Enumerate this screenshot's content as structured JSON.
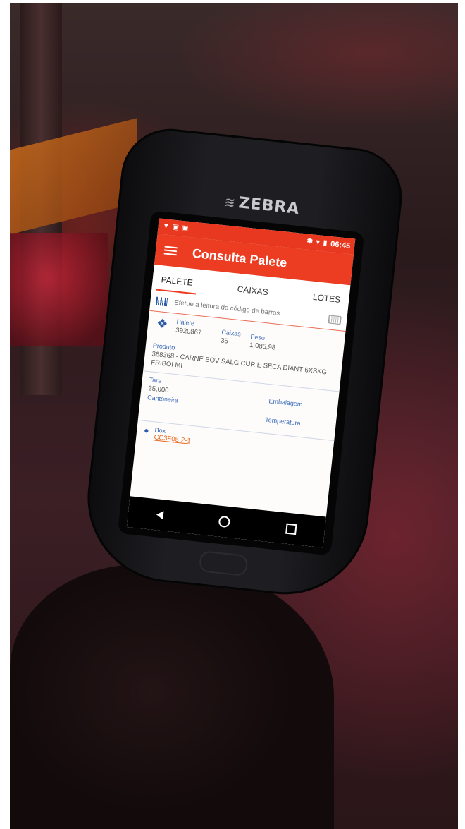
{
  "device": {
    "brand": "ZEBRA"
  },
  "status_bar": {
    "time": "06:45"
  },
  "app_bar": {
    "title": "Consulta Palete"
  },
  "tabs": [
    {
      "label": "PALETE",
      "active": true
    },
    {
      "label": "CAIXAS",
      "active": false
    },
    {
      "label": "LOTES",
      "active": false
    }
  ],
  "scan": {
    "placeholder": "Efetue a leitura do código de barras"
  },
  "pallet": {
    "palete_label": "Palete",
    "palete_value": "3920867",
    "caixas_label": "Caixas",
    "caixas_value": "35",
    "peso_label": "Peso",
    "peso_value": "1.085,98",
    "produto_label": "Produto",
    "produto_value": "368368 - CARNE BOV SALG CUR E SECA DIANT 6XSKG FRIBOI MI"
  },
  "details": {
    "tara_label": "Tara",
    "tara_value": "35,000",
    "embalagem_label": "Embalagem",
    "cantoneira_label": "Cantoneira",
    "temperatura_label": "Temperatura"
  },
  "location": {
    "box_label": "Box",
    "box_value": "CC3F05-2-1"
  },
  "colors": {
    "accent": "#ec3c22",
    "label_blue": "#3a6ab8",
    "link_orange": "#e8691f"
  }
}
